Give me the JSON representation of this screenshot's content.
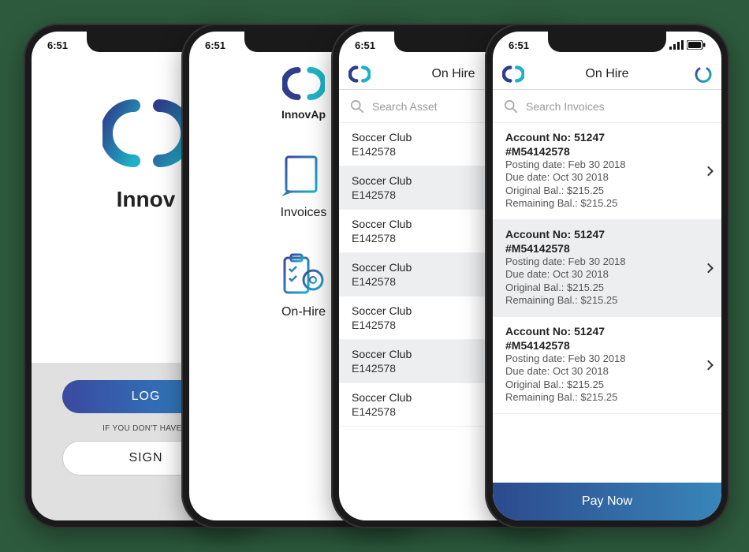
{
  "status_time": "6:51",
  "brand_full": "InnovApp",
  "brand_partial_s1": "Innov",
  "brand_partial_s2": "InnovAp",
  "screen1": {
    "login_label": "LOG",
    "note": "IF YOU DON'T HAVE A",
    "signup_label": "SIGN"
  },
  "screen2": {
    "menu": [
      {
        "label": "Invoices"
      },
      {
        "label": "On-Hire"
      }
    ]
  },
  "screen3": {
    "title": "On Hire",
    "search_placeholder": "Search Asset",
    "rows": [
      {
        "title": "Soccer Club",
        "sub": "E142578"
      },
      {
        "title": "Soccer Club",
        "sub": "E142578"
      },
      {
        "title": "Soccer Club",
        "sub": "E142578"
      },
      {
        "title": "Soccer Club",
        "sub": "E142578"
      },
      {
        "title": "Soccer Club",
        "sub": "E142578"
      },
      {
        "title": "Soccer Club",
        "sub": "E142578"
      },
      {
        "title": "Soccer Club",
        "sub": "E142578"
      }
    ]
  },
  "screen4": {
    "title": "On Hire",
    "search_placeholder": "Search Invoices",
    "rows": [
      {
        "acct": "Account No: 51247",
        "ref": "#M54142578",
        "posting": "Posting date: Feb 30 2018",
        "due": "Due date: Oct 30 2018",
        "orig": "Original Bal.: $215.25",
        "rem": "Remaining Bal.: $215.25"
      },
      {
        "acct": "Account No: 51247",
        "ref": "#M54142578",
        "posting": "Posting date: Feb 30 2018",
        "due": "Due date: Oct 30 2018",
        "orig": "Original Bal.: $215.25",
        "rem": "Remaining Bal.: $215.25"
      },
      {
        "acct": "Account No: 51247",
        "ref": "#M54142578",
        "posting": "Posting date: Feb 30 2018",
        "due": "Due date: Oct 30 2018",
        "orig": "Original Bal.: $215.25",
        "rem": "Remaining Bal.: $215.25"
      }
    ],
    "pay_label": "Pay Now"
  }
}
